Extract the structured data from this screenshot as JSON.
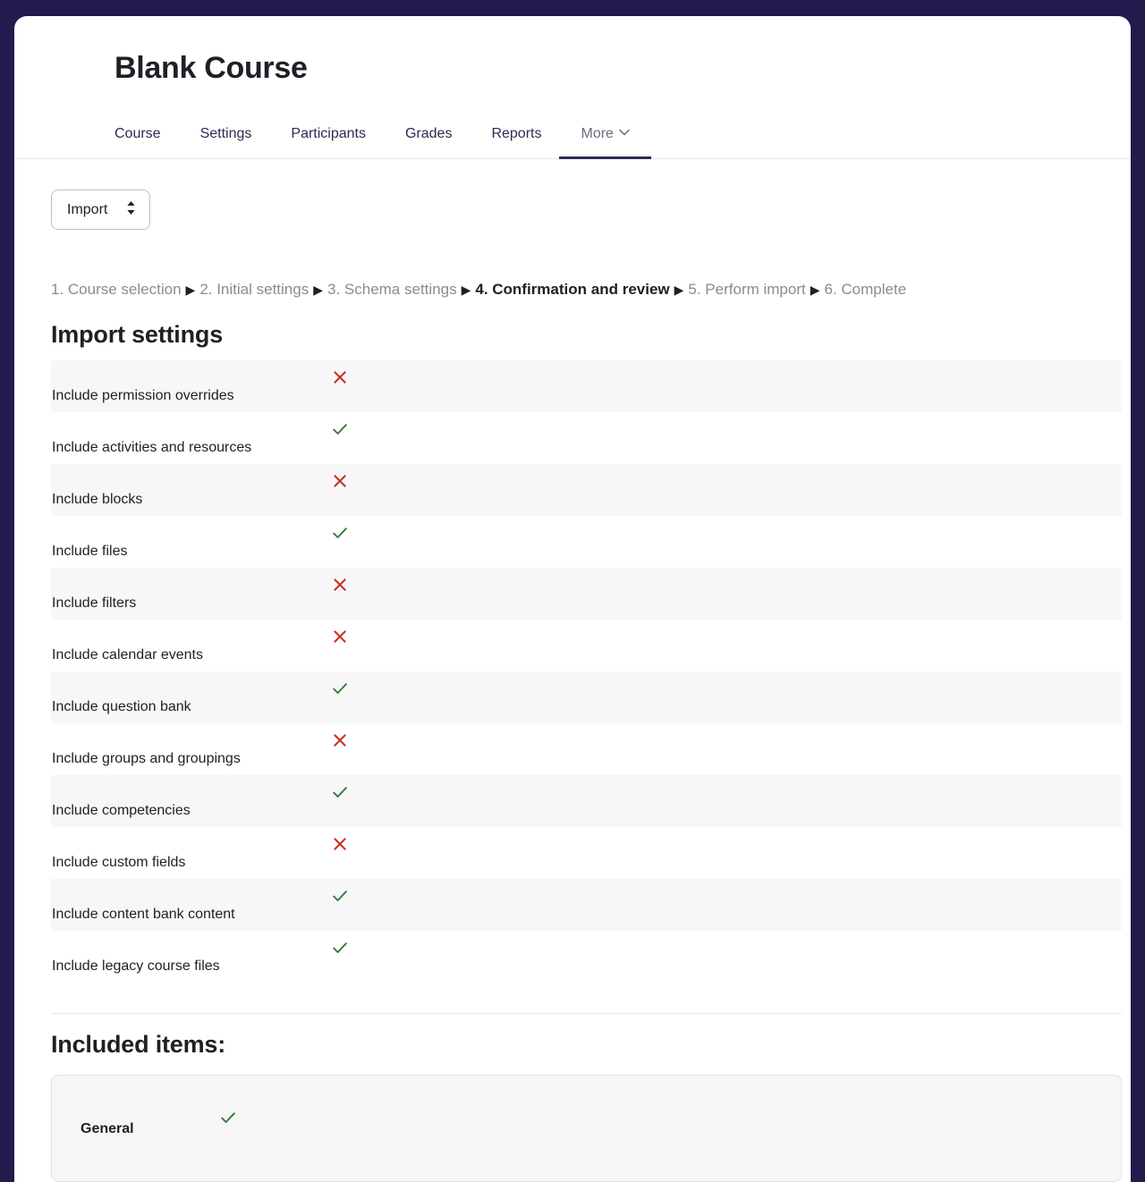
{
  "theme": {
    "page_background": "#251a4d",
    "card_background": "#ffffff",
    "accent": "#2b2a50",
    "yes_color": "#357a38",
    "no_color": "#ca3120",
    "stripe": "#f7f7f8"
  },
  "header": {
    "title": "Blank Course",
    "tabs": [
      {
        "label": "Course",
        "active": false,
        "has_chevron": false
      },
      {
        "label": "Settings",
        "active": false,
        "has_chevron": false
      },
      {
        "label": "Participants",
        "active": false,
        "has_chevron": false
      },
      {
        "label": "Grades",
        "active": false,
        "has_chevron": false
      },
      {
        "label": "Reports",
        "active": false,
        "has_chevron": false
      },
      {
        "label": "More",
        "active": true,
        "has_chevron": true
      }
    ]
  },
  "jump_select": {
    "value": "Import",
    "options": [
      "Import"
    ]
  },
  "breadcrumb": {
    "separator": "▶",
    "steps": [
      {
        "label": "1. Course selection",
        "current": false
      },
      {
        "label": "2. Initial settings",
        "current": false
      },
      {
        "label": "3. Schema settings",
        "current": false
      },
      {
        "label": "4. Confirmation and review",
        "current": true
      },
      {
        "label": "5. Perform import",
        "current": false
      },
      {
        "label": "6. Complete",
        "current": false
      }
    ]
  },
  "import_settings": {
    "title": "Import settings",
    "rows": [
      {
        "label": "Include permission overrides",
        "value": false
      },
      {
        "label": "Include activities and resources",
        "value": true
      },
      {
        "label": "Include blocks",
        "value": false
      },
      {
        "label": "Include files",
        "value": true
      },
      {
        "label": "Include filters",
        "value": false
      },
      {
        "label": "Include calendar events",
        "value": false
      },
      {
        "label": "Include question bank",
        "value": true
      },
      {
        "label": "Include groups and groupings",
        "value": false
      },
      {
        "label": "Include competencies",
        "value": true
      },
      {
        "label": "Include custom fields",
        "value": false
      },
      {
        "label": "Include content bank content",
        "value": true
      },
      {
        "label": "Include legacy course files",
        "value": true
      }
    ]
  },
  "included_items": {
    "title": "Included items:",
    "rows": [
      {
        "label": "General",
        "value": true
      }
    ]
  }
}
